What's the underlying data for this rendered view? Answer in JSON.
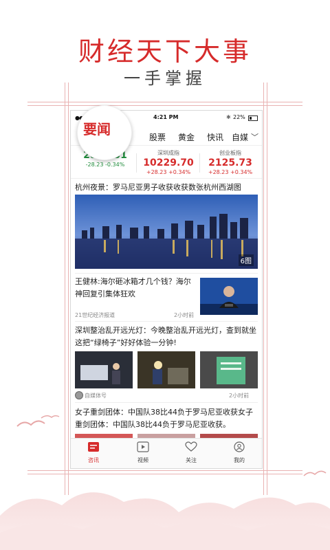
{
  "promo": {
    "title": "财经天下大事",
    "subtitle": "一手掌握"
  },
  "status_bar": {
    "signal": "●●●●○",
    "time": "4:21 PM",
    "battery": "22%"
  },
  "nav": {
    "active_tab": "要闻",
    "tabs": [
      "股票",
      "黄金",
      "快讯",
      "自媒"
    ]
  },
  "indices": [
    {
      "name": "",
      "value": "2890.31",
      "change": "-28.23",
      "percent": "-0.34%",
      "color": "#1f8c3b"
    },
    {
      "name": "深圳成指",
      "value": "10229.70",
      "change": "+28.23",
      "percent": "+0.34%",
      "color": "#d62b2b"
    },
    {
      "name": "创业板指",
      "value": "2125.73",
      "change": "+28.23",
      "percent": "+0.34%",
      "color": "#d62b2b"
    }
  ],
  "feed": {
    "item1": {
      "title": "杭州夜景：罗马尼亚男子收获收获数张杭州西湖图",
      "badge": "6图"
    },
    "item2": {
      "title": "王健林:海尔砸冰箱才几个钱？海尔神回复引集体狂欢",
      "source": "21世纪经济报道",
      "time": "2小时前"
    },
    "item3": {
      "title": "深圳整治乱开远光灯：今晚整治乱开远光灯，查到就坐这把“绿椅子”好好体验一分钟!",
      "source": "自媒体号",
      "time": "2小时前"
    },
    "item4": {
      "title": "女子重剑团体：中国队38比44负于罗马尼亚收获女子重剑团体：中国队38比44负于罗马尼亚收获。"
    }
  },
  "tabbar": {
    "items": [
      {
        "label": "咨讯",
        "icon": "news-icon"
      },
      {
        "label": "视频",
        "icon": "video-icon"
      },
      {
        "label": "关注",
        "icon": "heart-icon"
      },
      {
        "label": "我的",
        "icon": "profile-icon"
      }
    ]
  },
  "colors": {
    "accent": "#d62b2b",
    "up": "#d62b2b",
    "down": "#1f8c3b"
  }
}
